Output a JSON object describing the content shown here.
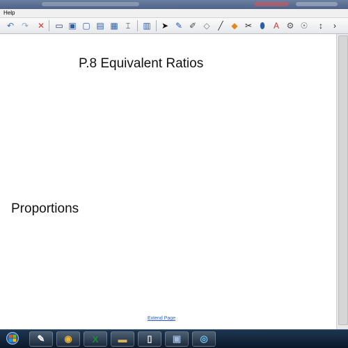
{
  "menu": {
    "help_label": "Help"
  },
  "toolbar": {
    "buttons": [
      {
        "name": "undo-icon",
        "glyph": "↶",
        "color": "#3a6fb5"
      },
      {
        "name": "redo-icon",
        "glyph": "↷",
        "color": "#9aa6b6"
      },
      {
        "name": "delete-icon",
        "glyph": "✕",
        "color": "#d33a2c"
      },
      {
        "name": "screen-shade-icon",
        "glyph": "▭",
        "color": "#2d3e63"
      },
      {
        "name": "full-screen-icon",
        "glyph": "▣",
        "color": "#2d5fa8"
      },
      {
        "name": "display-icon",
        "glyph": "▢",
        "color": "#2d5fa8"
      },
      {
        "name": "monitor-icon",
        "glyph": "▤",
        "color": "#2d5fa8"
      },
      {
        "name": "screen-capture-icon",
        "glyph": "▦",
        "color": "#2d5fa8"
      },
      {
        "name": "capture-area-icon",
        "glyph": "⌶",
        "color": "#333333"
      },
      {
        "name": "table-icon",
        "glyph": "▥",
        "color": "#2d5fa8"
      },
      {
        "name": "select-arrow-icon",
        "glyph": "➤",
        "color": "#111111"
      },
      {
        "name": "pen-icon",
        "glyph": "✎",
        "color": "#1f5bb8"
      },
      {
        "name": "creative-pen-icon",
        "glyph": "✐",
        "color": "#4a4a4a"
      },
      {
        "name": "eraser-icon",
        "glyph": "◇",
        "color": "#777777"
      },
      {
        "name": "line-icon",
        "glyph": "╱",
        "color": "#333333"
      },
      {
        "name": "shapes-icon",
        "glyph": "◆",
        "color": "#e08a1e"
      },
      {
        "name": "magic-pen-icon",
        "glyph": "✂",
        "color": "#222222"
      },
      {
        "name": "fill-icon",
        "glyph": "⬮",
        "color": "#2d5fa8"
      },
      {
        "name": "text-icon",
        "glyph": "A",
        "color": "#c0392b"
      },
      {
        "name": "properties-icon",
        "glyph": "⚙",
        "color": "#555555"
      },
      {
        "name": "scan-icon",
        "glyph": "☉",
        "color": "#666666"
      },
      {
        "name": "move-toolbar-icon",
        "glyph": "↕",
        "color": "#222222"
      },
      {
        "name": "more-icon",
        "glyph": "›",
        "color": "#222222"
      }
    ]
  },
  "page": {
    "title": "P.8 Equivalent Ratios",
    "heading": "Proportions",
    "extend_link": "Extend Page"
  },
  "taskbar": {
    "start_icon": "windows-start-icon",
    "apps": [
      {
        "name": "network-app-icon",
        "glyph": "⊞",
        "color": "#7fb2ff"
      },
      {
        "name": "notebook-app-icon",
        "glyph": "✎",
        "color": "#ffffff"
      },
      {
        "name": "chrome-icon",
        "glyph": "◉",
        "color": "#e8b43a"
      },
      {
        "name": "excel-icon",
        "glyph": "X",
        "color": "#1f8a3c"
      },
      {
        "name": "folder-icon",
        "glyph": "▬",
        "color": "#d8b35a"
      },
      {
        "name": "document-icon",
        "glyph": "▯",
        "color": "#e8e8e8"
      },
      {
        "name": "app-icon",
        "glyph": "▣",
        "color": "#9fb8d8"
      },
      {
        "name": "smart-board-icon",
        "glyph": "◎",
        "color": "#6ec0f0"
      }
    ]
  },
  "colors": {
    "link": "#2a5bd7",
    "taskbar": "#0c1a2c"
  }
}
